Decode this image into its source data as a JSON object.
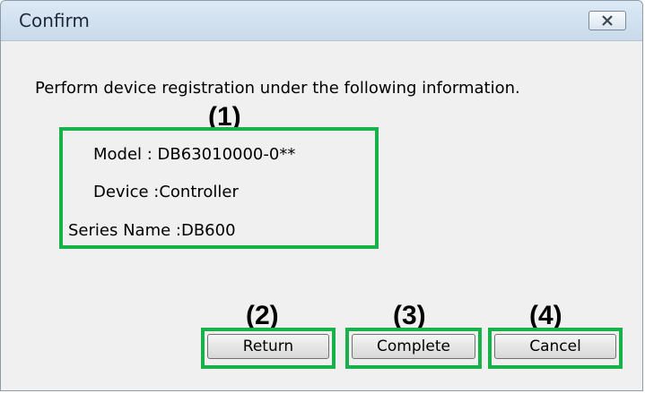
{
  "window": {
    "title": "Confirm"
  },
  "message": "Perform device registration under the following information.",
  "info": {
    "model": "Model : DB63010000-0**",
    "device": "Device :Controller",
    "series": "Series Name :DB600"
  },
  "callouts": [
    "(1)",
    "(2)",
    "(3)",
    "(4)"
  ],
  "buttons": {
    "return_label": "Return",
    "complete_label": "Complete",
    "cancel_label": "Cancel"
  },
  "colors": {
    "highlight": "#19b14a",
    "titlebar": "#c9daea",
    "dialog_bg": "#f0f0f0"
  },
  "icons": {
    "close": "close-icon"
  }
}
